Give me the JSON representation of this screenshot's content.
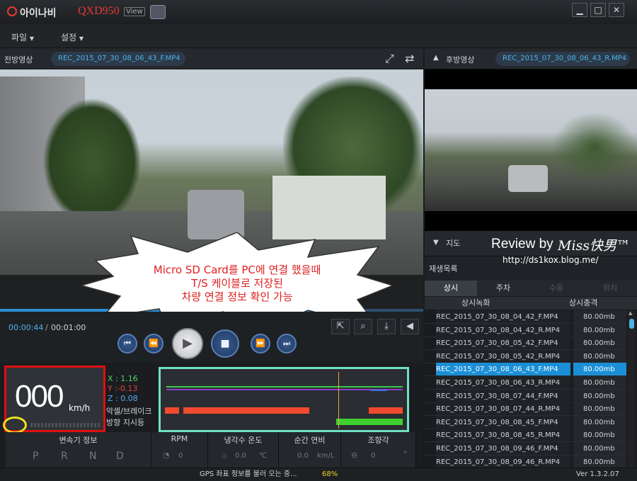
{
  "app": {
    "brand": "아이나비",
    "model": "QXD950",
    "model_tag": "View"
  },
  "window_controls": {
    "minimize": "▁",
    "maximize": "□",
    "close": "✕"
  },
  "menu": {
    "file": "파일",
    "settings": "설정"
  },
  "front": {
    "title": "전방영상",
    "file": "REC_2015_07_30_08_06_43_F.MP4"
  },
  "rear": {
    "title": "후방영상",
    "file": "REC_2015_07_30_08_06_43_R.MP4"
  },
  "playback": {
    "current": "00:00:44",
    "separator": "/",
    "total": "00:01:00",
    "progress": 0.73
  },
  "callout": {
    "line1": "Micro SD Card를 PC에 연결 했을때",
    "line2": "T/S 케이블로 저장된",
    "line3": "차량 연결 정보 확인 가능"
  },
  "watermark": {
    "review": "Review by",
    "author": "Miss快男™",
    "url": "http://ds1kox.blog.me/"
  },
  "speed": {
    "value": "000",
    "unit": "km/h"
  },
  "sensor": {
    "x": "X : 1.16",
    "y": "Y :-0.13",
    "z": "Z : 0.08",
    "brake": "악셀/브레이크",
    "turn": "방향 지시등"
  },
  "map_panel": {
    "title": "지도"
  },
  "playlist": {
    "title": "재생목록",
    "tabs": [
      "상시",
      "주차",
      "수동",
      "위치"
    ],
    "col_file": "상시녹화",
    "col_event": "상시충격",
    "rows": [
      {
        "file": "REC_2015_07_30_08_04_42_F.MP4",
        "size": "80.00mb",
        "selected": false
      },
      {
        "file": "REC_2015_07_30_08_04_42_R.MP4",
        "size": "80.00mb",
        "selected": false
      },
      {
        "file": "REC_2015_07_30_08_05_42_F.MP4",
        "size": "80.00mb",
        "selected": false
      },
      {
        "file": "REC_2015_07_30_08_05_42_R.MP4",
        "size": "80.00mb",
        "selected": false
      },
      {
        "file": "REC_2015_07_30_08_06_43_F.MP4",
        "size": "80.00mb",
        "selected": true
      },
      {
        "file": "REC_2015_07_30_08_06_43_R.MP4",
        "size": "80.00mb",
        "selected": false
      },
      {
        "file": "REC_2015_07_30_08_07_44_F.MP4",
        "size": "80.00mb",
        "selected": false
      },
      {
        "file": "REC_2015_07_30_08_07_44_R.MP4",
        "size": "80.00mb",
        "selected": false
      },
      {
        "file": "REC_2015_07_30_08_08_45_F.MP4",
        "size": "80.00mb",
        "selected": false
      },
      {
        "file": "REC_2015_07_30_08_08_45_R.MP4",
        "size": "80.00mb",
        "selected": false
      },
      {
        "file": "REC_2015_07_30_08_09_46_F.MP4",
        "size": "80.00mb",
        "selected": false
      },
      {
        "file": "REC_2015_07_30_08_09_46_R.MP4",
        "size": "80.00mb",
        "selected": false
      }
    ]
  },
  "stats": {
    "gear": {
      "title": "변속기 정보",
      "values": [
        "P",
        "R",
        "N",
        "D"
      ]
    },
    "rpm": {
      "title": "RPM",
      "value": "0"
    },
    "coolant": {
      "title": "냉각수 온도",
      "value": "0.0",
      "unit": "℃"
    },
    "fuel": {
      "title": "순간 연비",
      "value": "0.0",
      "unit": "km/L"
    },
    "steer": {
      "title": "조향각",
      "value": "0",
      "unit": "°"
    }
  },
  "status": {
    "gps": "GPS 좌표 정보를 불러 오는 중...",
    "percent": "68%",
    "version": "Ver 1.3.2.07"
  },
  "colors": {
    "accent": "#1a8fd6",
    "callout_text": "#e02020",
    "red_box": "#e01010",
    "teal_box": "#6fe0c4",
    "speed_text": "#ffffff"
  }
}
